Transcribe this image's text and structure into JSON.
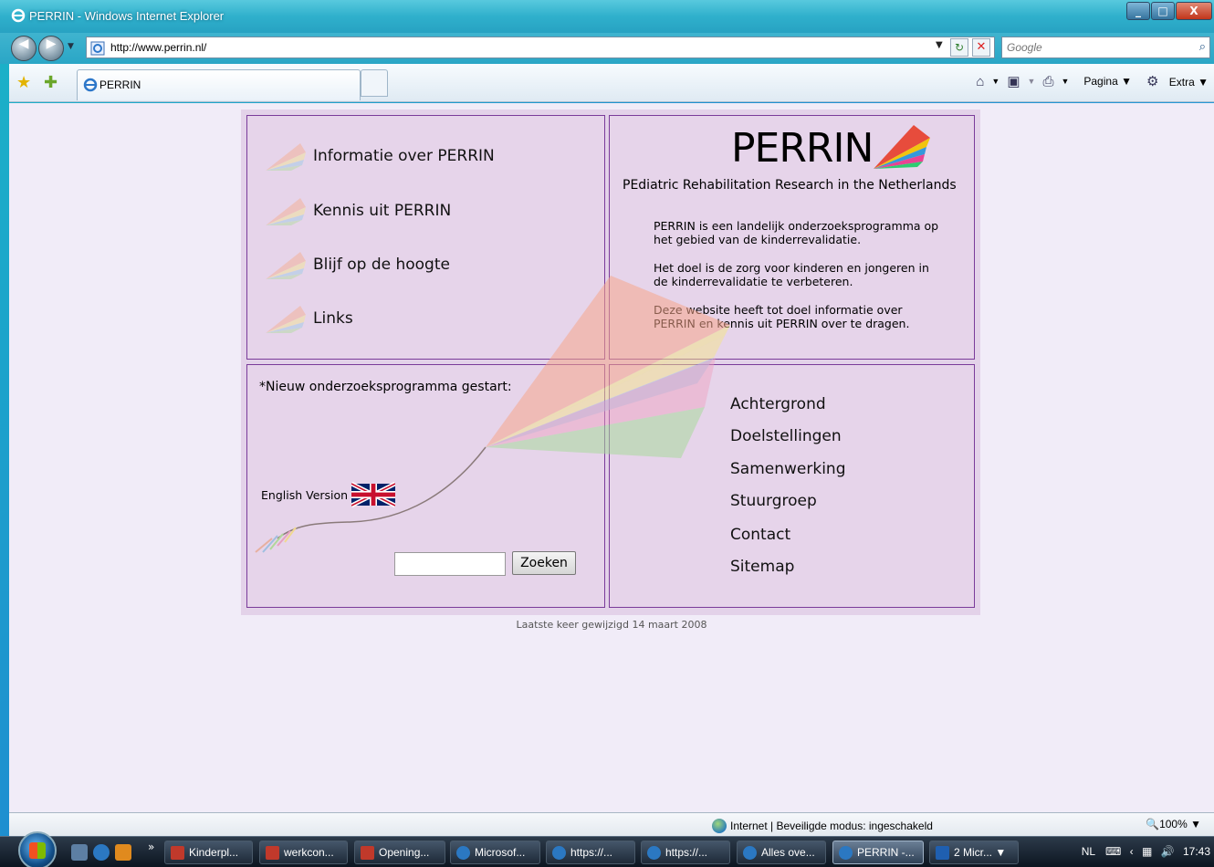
{
  "window": {
    "title": "PERRIN - Windows Internet Explorer",
    "controls": [
      "_",
      "□",
      "X"
    ]
  },
  "address_bar": {
    "url": "http://www.perrin.nl/",
    "search_placeholder": "Google"
  },
  "tabs": [
    {
      "label": "PERRIN"
    }
  ],
  "command_bar": {
    "page_label": "Pagina",
    "extra_label": "Extra"
  },
  "site": {
    "menu": [
      {
        "label": "Informatie over PERRIN"
      },
      {
        "label": "Kennis uit PERRIN"
      },
      {
        "label": "Blijf op de hoogte"
      },
      {
        "label": "Links"
      }
    ],
    "logo_text": "PERRIN",
    "subtitle": "PEdiatric Rehabilitation Research in the Netherlands",
    "paragraphs": [
      "PERRIN is een landelijk onderzoeksprogramma op het gebied van de kinderrevalidatie.",
      "Het doel is de zorg voor kinderen en jongeren in de kinderrevalidatie te verbeteren.",
      "Deze website heeft tot doel informatie over PERRIN en kennis uit PERRIN over te dragen."
    ],
    "news_label": "*Nieuw onderzoeksprogramma gestart:",
    "english_label": "English Version",
    "search_button": "Zoeken",
    "right_links": [
      {
        "label": "Achtergrond"
      },
      {
        "label": "Doelstellingen"
      },
      {
        "label": "Samenwerking"
      },
      {
        "label": "Stuurgroep"
      },
      {
        "label": "Contact"
      },
      {
        "label": "Sitemap"
      }
    ],
    "footer": "Laatste keer gewijzigd 14 maart 2008"
  },
  "status_bar": {
    "zone": "Internet | Beveiligde modus: ingeschakeld",
    "zoom": "100%"
  },
  "taskbar": {
    "items": [
      {
        "label": "Kinderpl...",
        "color": "#c0392b"
      },
      {
        "label": "werkcon...",
        "color": "#c0392b"
      },
      {
        "label": "Opening...",
        "color": "#c0392b"
      },
      {
        "label": "Microsof...",
        "color": "#2b78c2"
      },
      {
        "label": "https://...",
        "color": "#2b78c2"
      },
      {
        "label": "https://...",
        "color": "#2b78c2"
      },
      {
        "label": "Alles ove...",
        "color": "#2b78c2"
      },
      {
        "label": "PERRIN -...",
        "color": "#2b78c2"
      },
      {
        "label": "2 Micr...",
        "color": "#1f5fb0"
      }
    ],
    "tray_lang": "NL",
    "time": "17:43"
  }
}
